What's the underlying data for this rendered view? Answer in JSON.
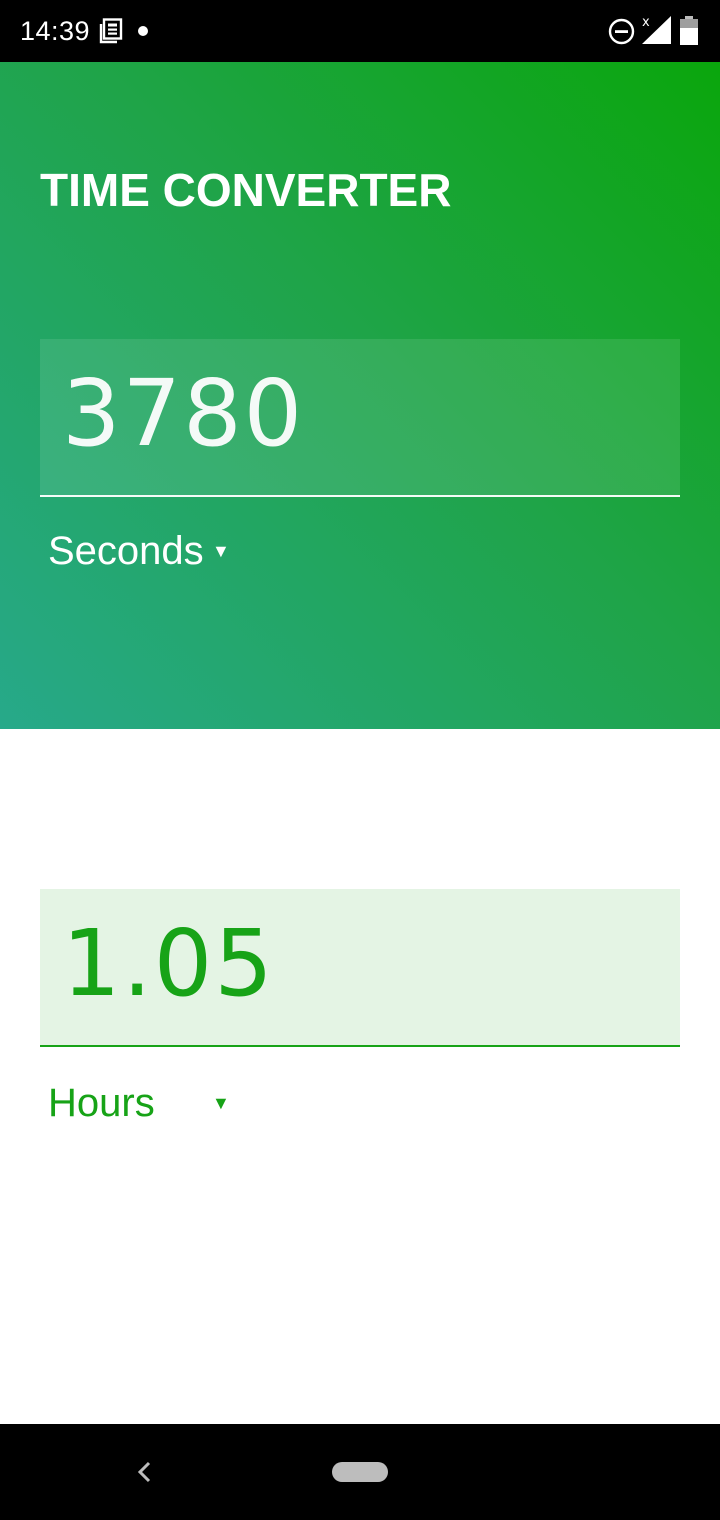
{
  "status_bar": {
    "time": "14:39",
    "icons": [
      "news-icon",
      "notification-dot-icon",
      "do-not-disturb-icon",
      "cellular-signal-icon",
      "battery-icon"
    ]
  },
  "app": {
    "title": "TIME CONVERTER"
  },
  "input": {
    "value": "3780",
    "unit": "Seconds",
    "arrow": "▼"
  },
  "output": {
    "value": "1.05",
    "unit": "Hours",
    "arrow": "▼"
  },
  "nav_bar": {
    "icons": [
      "back-icon",
      "home-pill-icon"
    ]
  },
  "colors": {
    "accent": "#17a317",
    "output_bg": "#e4f4e4",
    "gradient_start": "#27a98a",
    "gradient_end": "#0aa60c"
  }
}
